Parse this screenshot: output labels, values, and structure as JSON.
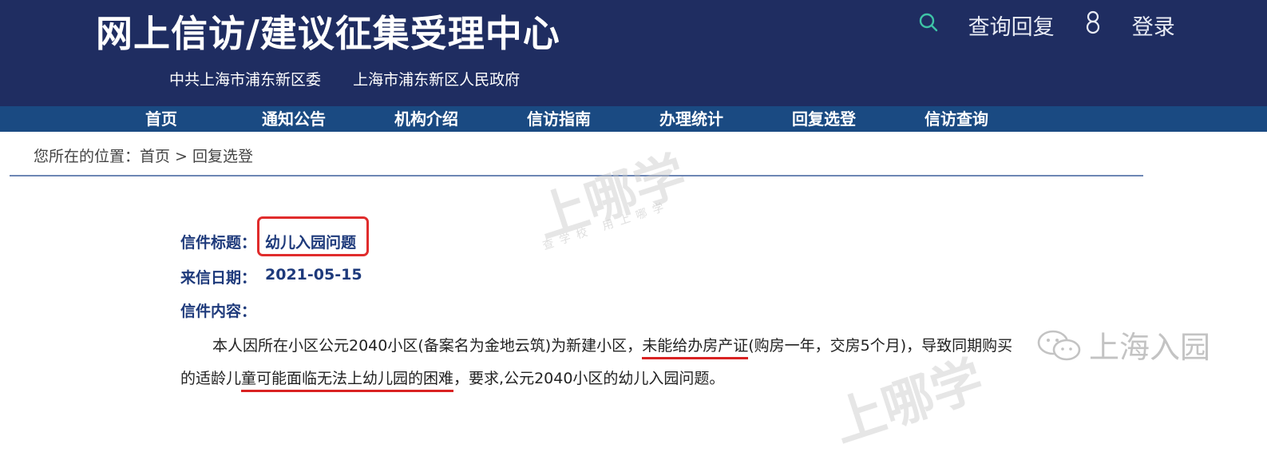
{
  "header": {
    "title": "网上信访/建议征集受理中心",
    "orgs": [
      "中共上海市浦东新区委",
      "上海市浦东新区人民政府"
    ],
    "query_label": "查询回复",
    "login_label": "登录"
  },
  "nav": {
    "items": [
      "首页",
      "通知公告",
      "机构介绍",
      "信访指南",
      "办理统计",
      "回复选登",
      "信访查询"
    ]
  },
  "breadcrumb": {
    "text": "您所在的位置：首页 > 回复选登"
  },
  "letter": {
    "title_label": "信件标题：",
    "title_value": "幼儿入园问题",
    "date_label": "来信日期：",
    "date_value": "2021-05-15",
    "content_label": "信件内容：",
    "content_line1_a": "本人因所在小区公元2040小区(备案名为金地云筑)为新建小区，",
    "content_line1_b": "未能给办房产证",
    "content_line1_c": "(购房一年，交房5个月)，导致同期购买",
    "content_line2_a": "的适龄儿",
    "content_line2_b": "童可能面临无法上幼儿园的困难",
    "content_line2_c": "，要求,公元2040小区的幼儿入园问题。"
  },
  "watermarks": {
    "brand": "上哪学",
    "tagline": "查学校 用上哪学",
    "wechat": "上海入园"
  }
}
